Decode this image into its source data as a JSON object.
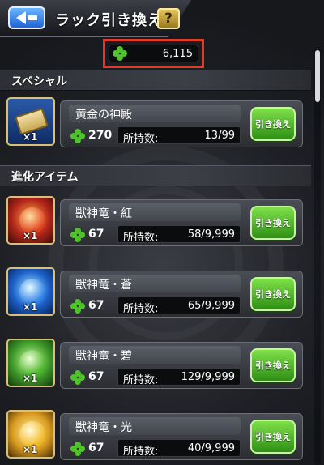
{
  "header": {
    "title": "ラック引き換え",
    "help_label": "?",
    "back_icon": "back-arrow-icon"
  },
  "luck": {
    "icon": "clover-icon",
    "value": "6,115"
  },
  "colors": {
    "accent_green": "#4fc32a",
    "highlight_red": "#e23a25",
    "button_green": "#2e8f15",
    "back_blue": "#1f63d8"
  },
  "sections": [
    {
      "label": "スペシャル",
      "items": [
        {
          "name": "黄金の神殿",
          "cost": "270",
          "stock_label": "所持数:",
          "stock": "13/99",
          "button": "引き換え",
          "count": "×1",
          "icon": "gold-ticket-icon"
        }
      ]
    },
    {
      "label": "進化アイテム",
      "items": [
        {
          "name": "獣神竜・紅",
          "cost": "67",
          "stock_label": "所持数:",
          "stock": "58/9,999",
          "button": "引き換え",
          "count": "×1",
          "icon": "fire-dragon-orb-icon"
        },
        {
          "name": "獣神竜・蒼",
          "cost": "67",
          "stock_label": "所持数:",
          "stock": "65/9,999",
          "button": "引き換え",
          "count": "×1",
          "icon": "water-dragon-orb-icon"
        },
        {
          "name": "獣神竜・碧",
          "cost": "67",
          "stock_label": "所持数:",
          "stock": "129/9,999",
          "button": "引き換え",
          "count": "×1",
          "icon": "wood-dragon-orb-icon"
        },
        {
          "name": "獣神竜・光",
          "cost": "67",
          "stock_label": "所持数:",
          "stock": "40/9,999",
          "button": "引き換え",
          "count": "×1",
          "icon": "light-dragon-orb-icon"
        }
      ]
    }
  ]
}
